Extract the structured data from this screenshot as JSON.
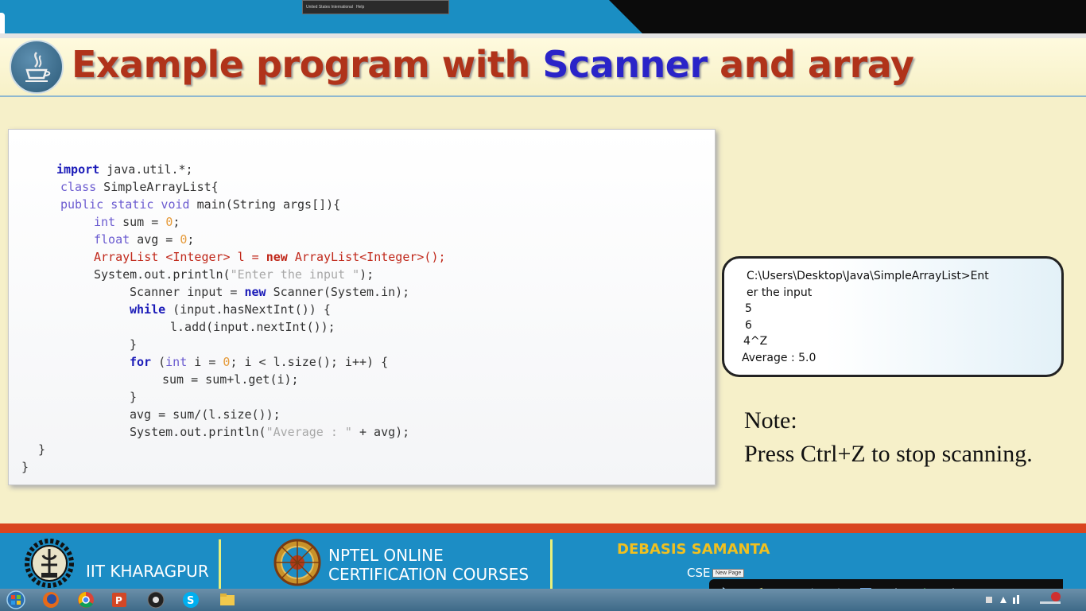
{
  "recorder_toolbar": {
    "items": [
      "United States International",
      "Help"
    ]
  },
  "slide": {
    "title_part1": "Example program with ",
    "title_highlight": "Scanner",
    "title_part2": " and array"
  },
  "code": {
    "l1": {
      "kw": "import",
      "rest": " java.util.*;"
    },
    "l2": {
      "kw": "class",
      "rest": " SimpleArrayList{"
    },
    "l3": {
      "kw": "public static void",
      "rest": " main(String args[]){"
    },
    "l4": {
      "kw": "int",
      "mid": " sum = ",
      "num": "0",
      "end": ";"
    },
    "l5": {
      "kw": "float",
      "mid": " avg = ",
      "num": "0",
      "end": ";"
    },
    "l6": {
      "a": "ArrayList ",
      "b": "<Integer>",
      "c": " l = ",
      "d": "new",
      "e": " ArrayList",
      "f": "<Integer>();"
    },
    "l7": {
      "a": "System.out.println(",
      "str": "\"Enter the input \"",
      "b": ");"
    },
    "l8": {
      "a": "Scanner input = ",
      "kw": "new",
      "b": " Scanner(System.in);"
    },
    "l9": {
      "kw": "while",
      "rest": " (input.hasNextInt()) {"
    },
    "l10": {
      "rest": "l.add(input.nextInt());"
    },
    "l11": {
      "rest": "}"
    },
    "l12": {
      "kw": "for",
      "a": " (",
      "kw2": "int",
      "b": " i = ",
      "num": "0",
      "c": "; i < l.size(); i++) {"
    },
    "l13": {
      "rest": "sum = sum+l.get(i);"
    },
    "l14": {
      "rest": "}"
    },
    "l15": {
      "rest": "avg = sum/(l.size());"
    },
    "l16": {
      "a": "System.out.println(",
      "str": "\"Average : \"",
      "b": " + avg);"
    },
    "l17": {
      "rest": "}"
    },
    "l18": {
      "rest": "}"
    }
  },
  "console": {
    "lines": [
      "C:\\Users\\Desktop\\Java\\SimpleArrayList>Ent",
      "er the input",
      "5",
      "6",
      "4^Z",
      "Average :  5.0"
    ]
  },
  "note": {
    "heading": "Note:",
    "text": "Press Ctrl+Z to stop scanning."
  },
  "footer": {
    "institute": "IIT KHARAGPUR",
    "nptel_line1": "NPTEL ONLINE",
    "nptel_line2": "CERTIFICATION COURSES",
    "presenter": "DEBASIS SAMANTA",
    "dept": "CSE",
    "tooltip": "New Page"
  },
  "taskbar": {
    "apps": [
      "start-orb",
      "firefox",
      "chrome",
      "powerpoint",
      "media-player",
      "skype",
      "file-explorer"
    ]
  },
  "colors": {
    "title_red": "#b0331a",
    "title_blue": "#2a24c8",
    "footer_blue": "#1c8dc5",
    "footer_red": "#d9451f",
    "presenter_gold": "#f0c020",
    "slide_bg": "#f6f0c9"
  }
}
